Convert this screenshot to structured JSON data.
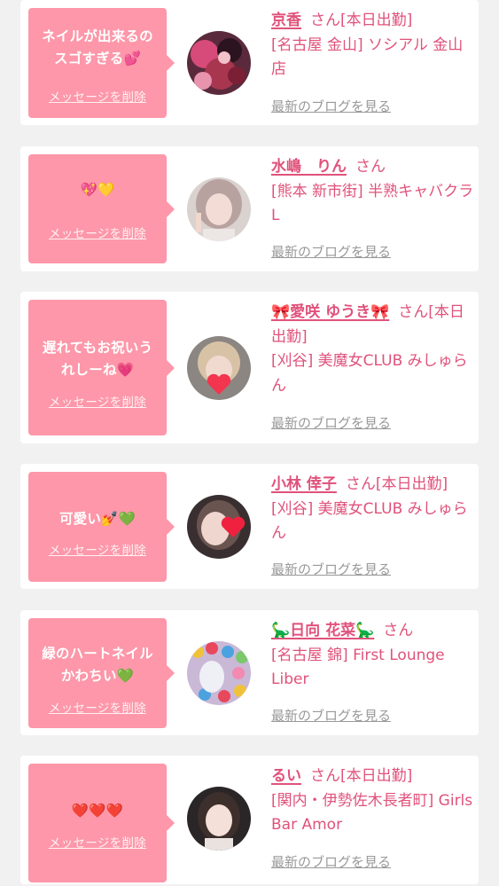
{
  "accent_color": "#fd97a9",
  "name_color": "#e0527b",
  "entries": [
    {
      "message": "ネイルが出来るの\nスゴすぎる💕",
      "delete_label": "メッセージを削除",
      "name": "京香",
      "honorific": "さん",
      "on_duty": "[本日出勤]",
      "shop": "[名古屋 金山] ソシアル 金山店",
      "blog_label": "最新のブログを見る"
    },
    {
      "message": "💖💛",
      "delete_label": "メッセージを削除",
      "name": "水嶋　りん",
      "honorific": "さん",
      "on_duty": "",
      "shop": "[熊本 新市街] 半熟キャバクラ L",
      "blog_label": "最新のブログを見る"
    },
    {
      "message": "遅れてもお祝いう\nれしーね💗",
      "delete_label": "メッセージを削除",
      "name": "🎀愛咲 ゆうき🎀",
      "honorific": "さん",
      "on_duty": "[本日出勤]",
      "shop": "[刈谷] 美魔女CLUB みしゅらん",
      "blog_label": "最新のブログを見る"
    },
    {
      "message": "可愛い💅💚",
      "delete_label": "メッセージを削除",
      "name": "小林 倖子",
      "honorific": "さん",
      "on_duty": "[本日出勤]",
      "shop": "[刈谷] 美魔女CLUB みしゅらん",
      "blog_label": "最新のブログを見る"
    },
    {
      "message": "緑のハートネイル\nかわちい💚",
      "delete_label": "メッセージを削除",
      "name": "🦕日向 花菜🦕",
      "honorific": "さん",
      "on_duty": "",
      "shop": "[名古屋 錦] First Lounge Liber",
      "blog_label": "最新のブログを見る"
    },
    {
      "message": "❤️❤️❤️",
      "delete_label": "メッセージを削除",
      "name": "るい",
      "honorific": "さん",
      "on_duty": "[本日出勤]",
      "shop": "[関内・伊勢佐木長者町] Girls Bar Amor",
      "blog_label": "最新のブログを見る"
    }
  ]
}
